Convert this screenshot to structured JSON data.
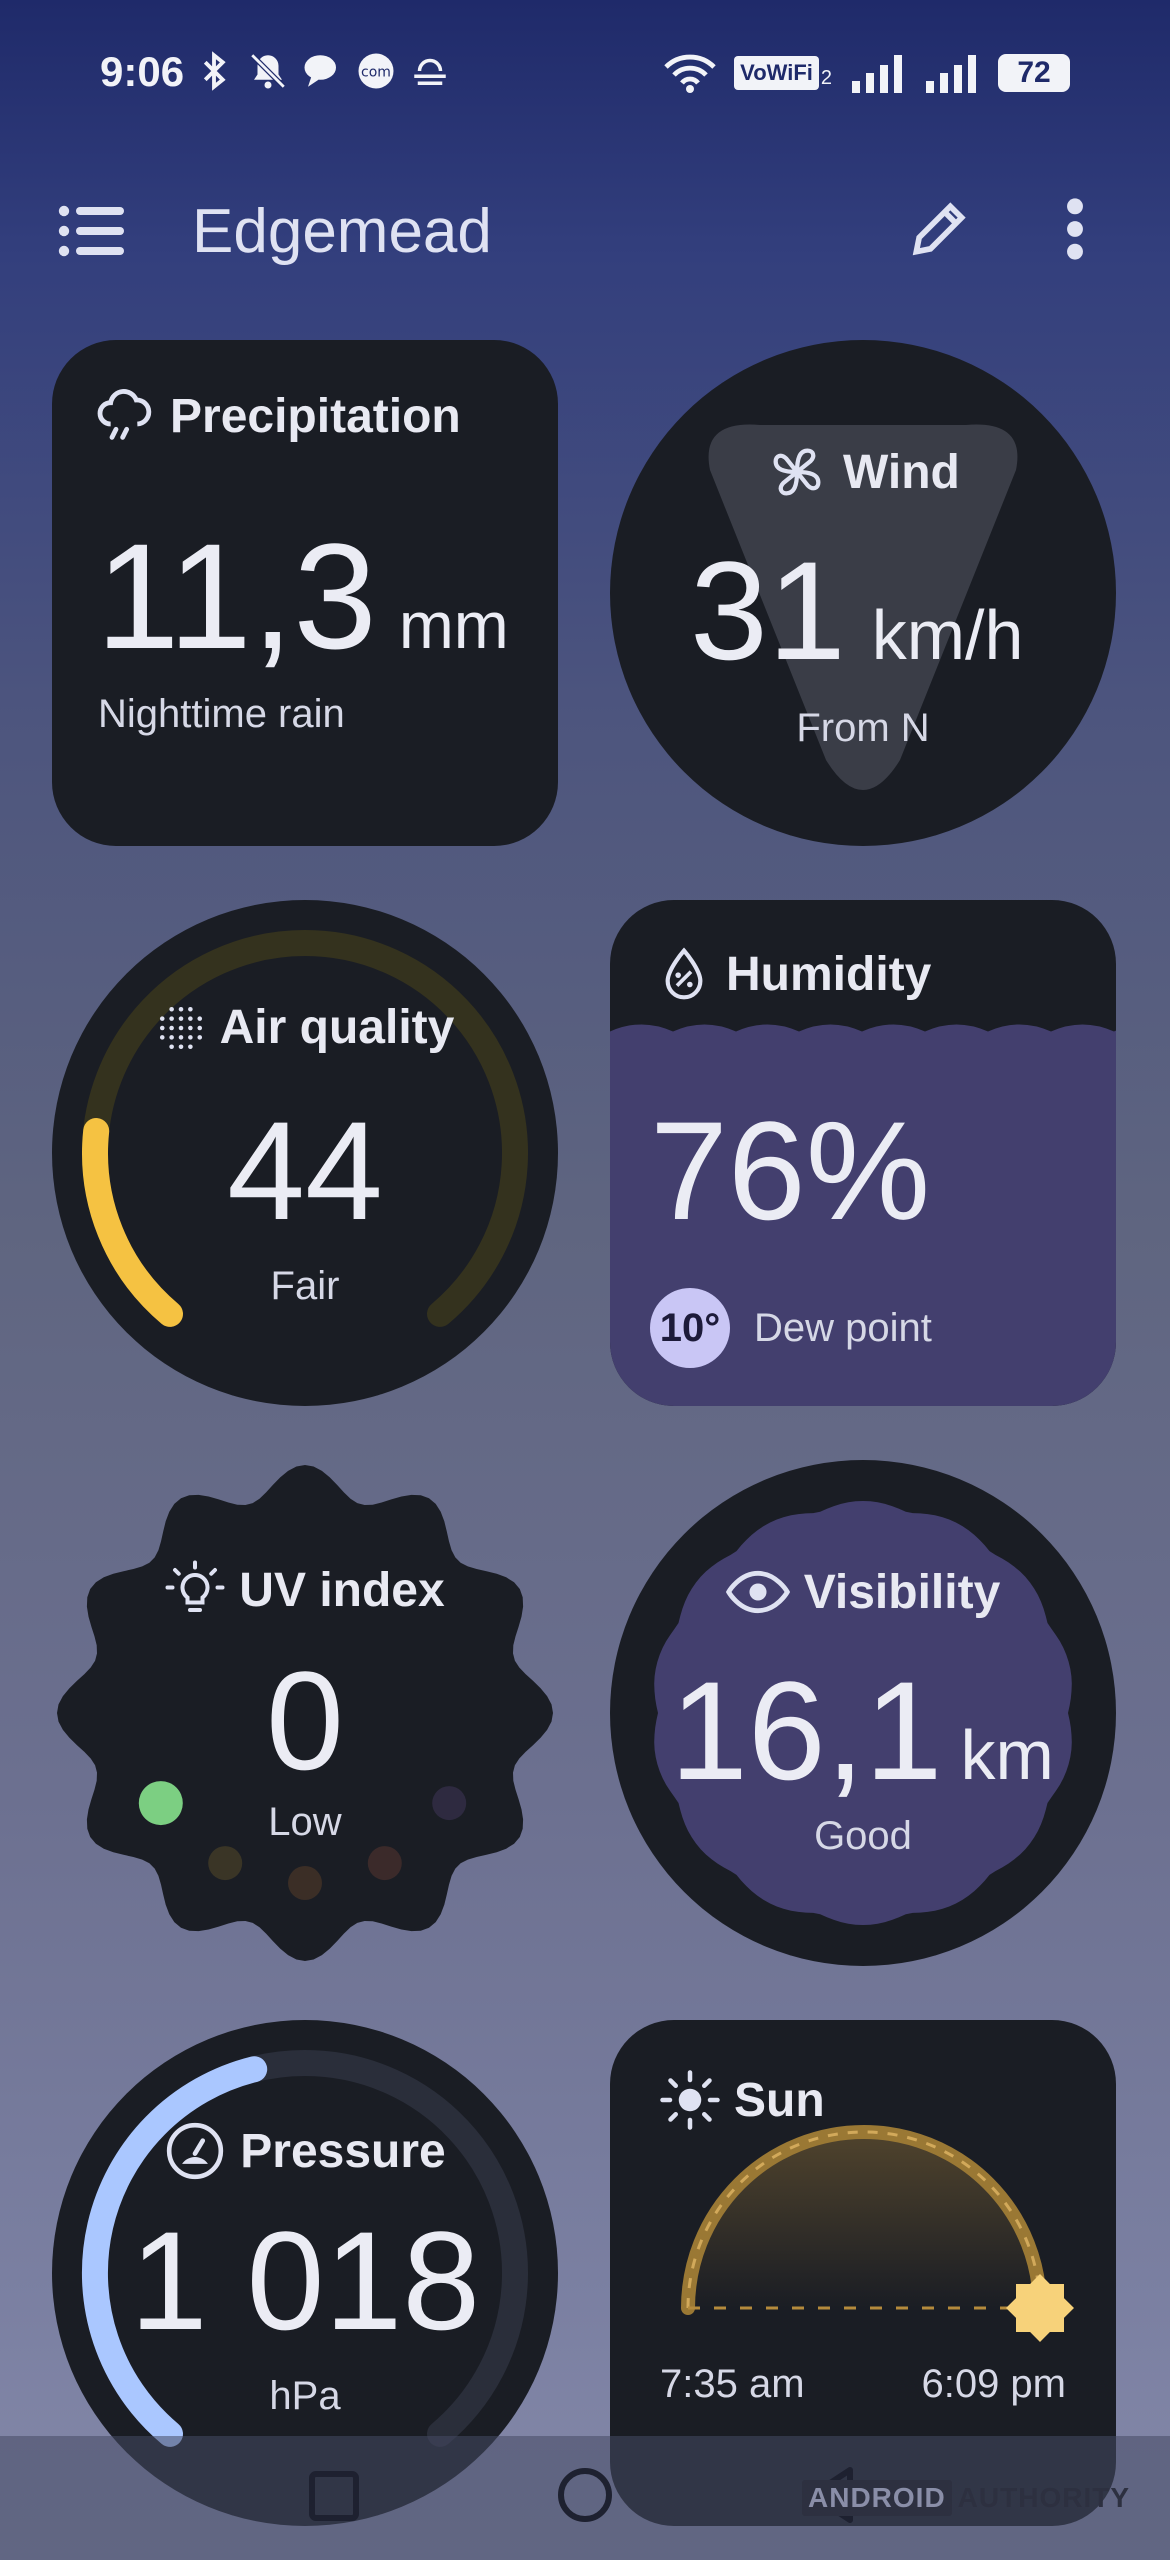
{
  "status_bar": {
    "time": "9:06",
    "vowifi": "VoWiFi",
    "vowifi_sub": "2",
    "battery": "72"
  },
  "app_bar": {
    "title": "Edgemead"
  },
  "cards": {
    "precipitation": {
      "title": "Precipitation",
      "value": "11,3",
      "unit": "mm",
      "caption": "Nighttime rain"
    },
    "wind": {
      "title": "Wind",
      "value": "31",
      "unit": "km/h",
      "caption": "From N"
    },
    "air_quality": {
      "title": "Air quality",
      "value": "44",
      "caption": "Fair",
      "level": 0.2
    },
    "humidity": {
      "title": "Humidity",
      "value": "76%",
      "dew_value": "10°",
      "dew_label": "Dew point",
      "level": 0.76
    },
    "uv_index": {
      "title": "UV index",
      "value": "0",
      "caption": "Low"
    },
    "visibility": {
      "title": "Visibility",
      "value": "16,1",
      "unit": "km",
      "caption": "Good"
    },
    "pressure": {
      "title": "Pressure",
      "value": "1 018",
      "unit": "hPa"
    },
    "sun": {
      "title": "Sun",
      "sunrise": "7:35 am",
      "sunset": "6:09 pm"
    }
  },
  "colors": {
    "card_bg": "#1a1d24",
    "humidity_fill": "#433f6e",
    "air_accent": "#f5c242",
    "pressure_accent": "#aac7ff",
    "sun_arc": "#b48a3c",
    "sun_icon": "#f7d27a",
    "uv_low": "#7ccf82"
  },
  "watermark": {
    "part1": "ANDROID",
    "part2": "AUTHORITY"
  }
}
